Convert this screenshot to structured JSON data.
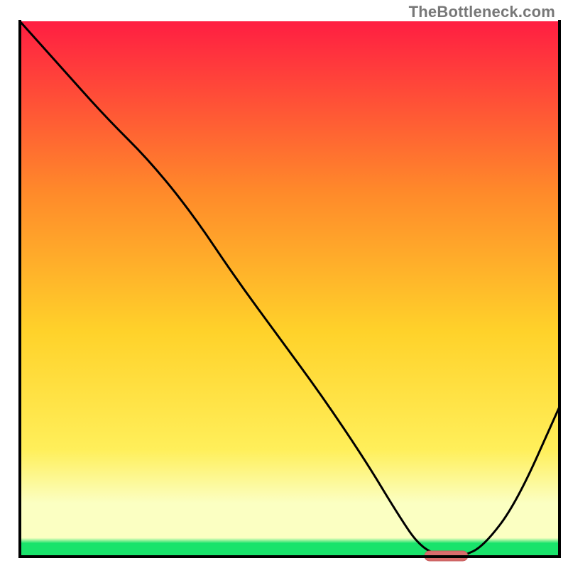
{
  "watermark": "TheBottleneck.com",
  "colors": {
    "frame": "#000000",
    "curve": "#000000",
    "marker_fill": "#d96d6d",
    "marker_stroke": "#c45a5a",
    "grad_top": "#ff1e42",
    "grad_upper_mid": "#ff8a2a",
    "grad_mid": "#ffd22a",
    "grad_lower_mid": "#ffef5a",
    "grad_pale": "#fbffc2",
    "grad_green": "#19e36b"
  },
  "chart_data": {
    "type": "line",
    "title": "",
    "xlabel": "",
    "ylabel": "",
    "xlim": [
      0,
      100
    ],
    "ylim": [
      0,
      100
    ],
    "x": [
      0,
      8,
      16,
      24,
      32,
      40,
      48,
      56,
      64,
      70,
      74,
      78,
      82,
      86,
      92,
      100
    ],
    "y": [
      100,
      91,
      82,
      74,
      64,
      52,
      41,
      30,
      18,
      8,
      2,
      0,
      0,
      2,
      10,
      28
    ],
    "marker": {
      "x_start": 75,
      "x_end": 83,
      "y": 0
    }
  }
}
